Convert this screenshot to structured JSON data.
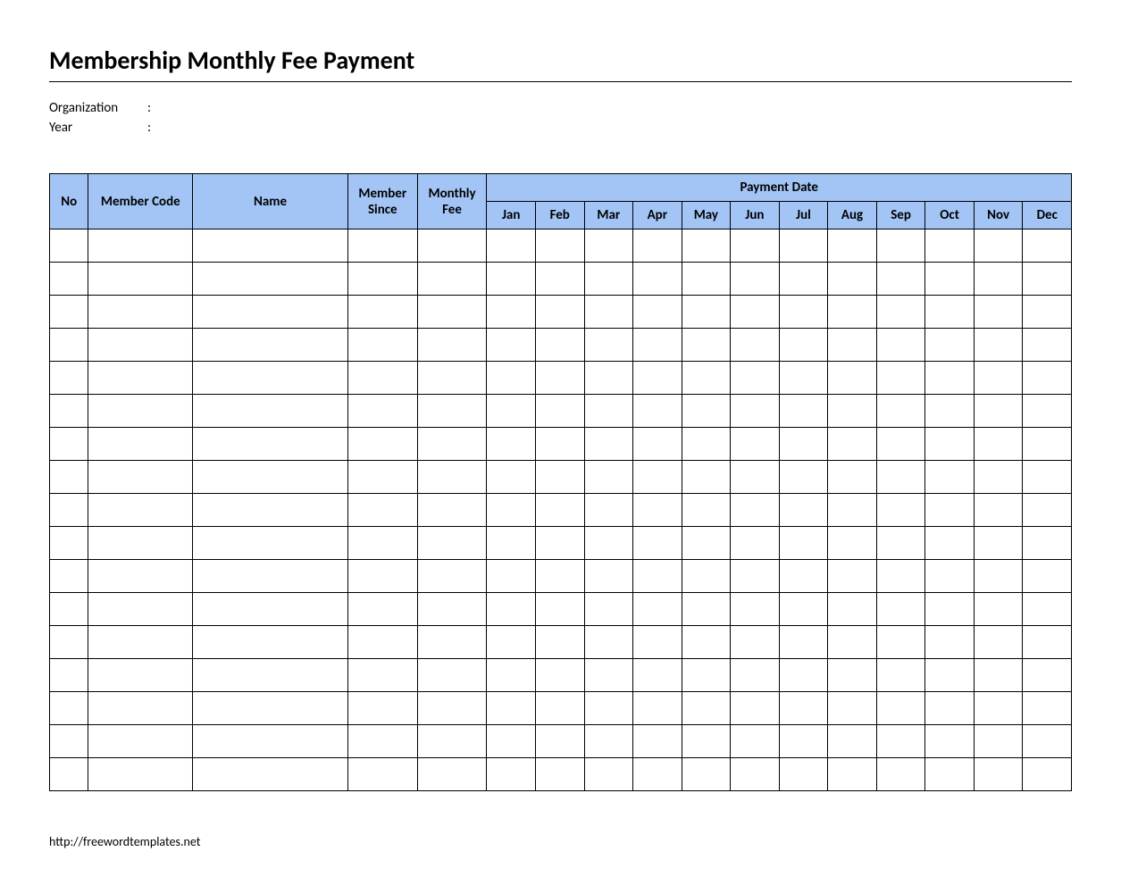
{
  "title": "Membership Monthly Fee Payment",
  "meta": {
    "organization_label": "Organization",
    "organization_value": "",
    "year_label": "Year",
    "year_value": "",
    "separator": ":"
  },
  "table": {
    "headers": {
      "no": "No",
      "member_code": "Member Code",
      "name": "Name",
      "member_since": "Member Since",
      "monthly_fee": "Monthly Fee",
      "payment_date": "Payment Date",
      "months": [
        "Jan",
        "Feb",
        "Mar",
        "Apr",
        "May",
        "Jun",
        "Jul",
        "Aug",
        "Sep",
        "Oct",
        "Nov",
        "Dec"
      ]
    },
    "row_count": 17
  },
  "footer": {
    "link_text": "http://freewordtemplates.net"
  }
}
